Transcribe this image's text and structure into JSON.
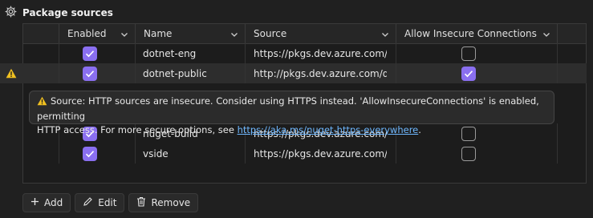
{
  "panel": {
    "title": "Package sources"
  },
  "columns": [
    {
      "label": "Enabled"
    },
    {
      "label": "Name"
    },
    {
      "label": "Source"
    },
    {
      "label": "Allow Insecure Connections"
    }
  ],
  "rows": [
    {
      "warn": false,
      "enabled": true,
      "name": "dotnet-eng",
      "source": "https://pkgs.dev.azure.com/dn",
      "insecure": false
    },
    {
      "warn": true,
      "enabled": true,
      "name": "dotnet-public",
      "source": "http://pkgs.dev.azure.com/dnc",
      "insecure": true
    },
    {
      "warn": false,
      "enabled": true,
      "name": "nuget-build",
      "source": "https://pkgs.dev.azure.com/dn",
      "insecure": false
    },
    {
      "warn": false,
      "enabled": true,
      "name": "vside",
      "source": "https://pkgs.dev.azure.com/azu",
      "insecure": false
    }
  ],
  "tooltip": {
    "line1": "Source: HTTP sources are insecure. Consider using HTTPS instead. 'AllowInsecureConnections' is enabled, permitting",
    "line2_prefix": "HTTP access. For more secure options, see ",
    "link": "https://aka.ms/nuget-https-everywhere",
    "line2_suffix": "."
  },
  "buttons": {
    "add": "Add",
    "edit": "Edit",
    "remove": "Remove"
  },
  "colors": {
    "accent": "#8a6ff0",
    "warning": "#f0c020",
    "link": "#6fb8ff"
  }
}
